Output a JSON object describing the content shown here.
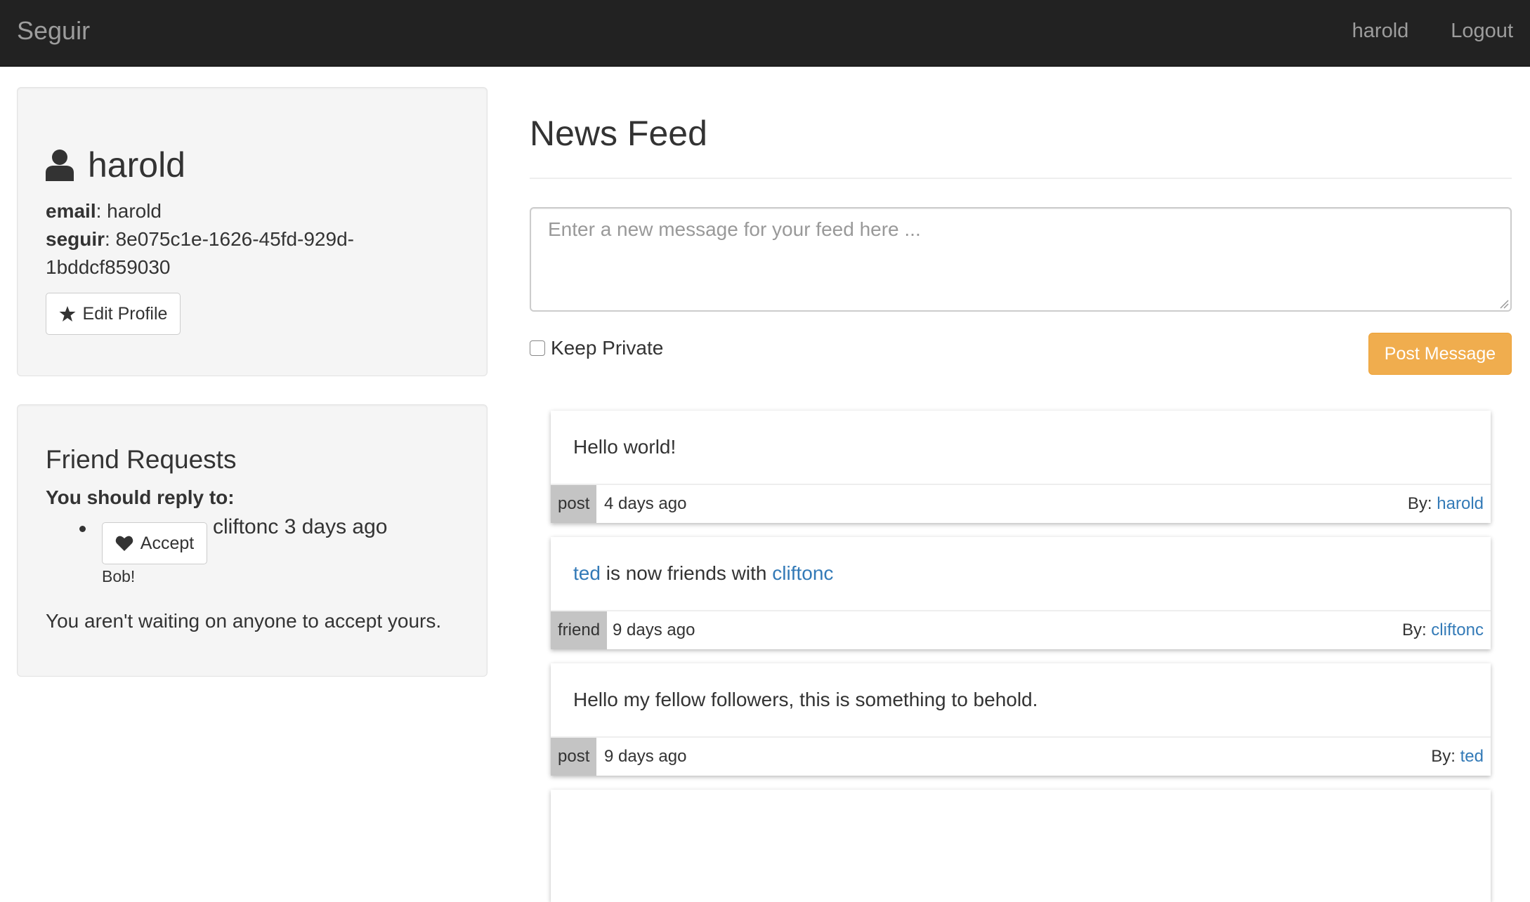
{
  "navbar": {
    "brand": "Seguir",
    "links": {
      "user": "harold",
      "logout": "Logout"
    }
  },
  "profile": {
    "name": "harold",
    "email_label": "email",
    "email_value": ": harold",
    "seguir_label": "seguir",
    "seguir_value_line1": ": 8e075c1e-1626-45fd-929d-",
    "seguir_value_line2": "1bddcf859030",
    "edit_button": "Edit Profile"
  },
  "friend_requests": {
    "title": "Friend Requests",
    "subtitle": "You should reply to:",
    "items": [
      {
        "accept_label": "Accept",
        "from_text": "cliftonc 3 days ago",
        "message": "Bob!"
      }
    ],
    "none_waiting": "You aren't waiting on anyone to accept yours."
  },
  "feed": {
    "title": "News Feed",
    "composer_placeholder": "Enter a new message for your feed here ...",
    "keep_private_label": "Keep Private",
    "post_button": "Post Message",
    "by_label": "By:",
    "items": [
      {
        "type": "post",
        "text": "Hello world!",
        "time": "4 days ago",
        "author": "harold"
      },
      {
        "type": "friend",
        "user_a": "ted",
        "middle": " is now friends with ",
        "user_b": "cliftonc",
        "time": "9 days ago",
        "author": "cliftonc"
      },
      {
        "type": "post",
        "text": "Hello my fellow followers, this is something to behold.",
        "time": "9 days ago",
        "author": "ted"
      }
    ]
  },
  "colors": {
    "navbar_bg": "#222222",
    "link": "#337ab7",
    "warning_button": "#f0ad4e",
    "well_bg": "#f5f5f5",
    "type_badge": "#c4c4c4"
  }
}
